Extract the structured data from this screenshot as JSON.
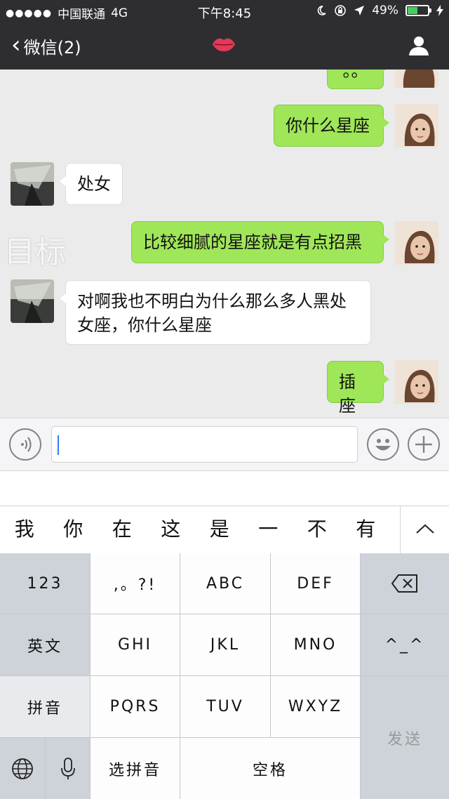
{
  "status_bar": {
    "carrier": "中国联通",
    "network": "4G",
    "time": "下午8:45",
    "battery": "49%",
    "battery_level": 0.49
  },
  "nav": {
    "back_label": "微信(2)",
    "title_icon": "lips-icon",
    "right_icon": "person-icon"
  },
  "messages": [
    {
      "side": "out",
      "text": "。。",
      "partial": true
    },
    {
      "side": "out",
      "text": "你什么星座"
    },
    {
      "side": "in",
      "text": "处女"
    },
    {
      "side": "out",
      "text": "比较细腻的星座就是有点招黑"
    },
    {
      "side": "in",
      "text": "对啊我也不明白为什么那么多人黑处女座，你什么星座"
    },
    {
      "side": "out",
      "text": "插座"
    }
  ],
  "watermark": "目标",
  "input": {
    "value": "",
    "voice_icon": "voice-icon",
    "emoji_icon": "emoji-icon",
    "plus_icon": "plus-icon"
  },
  "candidates": [
    "我",
    "你",
    "在",
    "这",
    "是",
    "一",
    "不",
    "有"
  ],
  "keyboard": {
    "num": "123",
    "punct": ",。?!",
    "abc": "ABC",
    "def": "DEF",
    "en": "英文",
    "ghi": "GHI",
    "jkl": "JKL",
    "mno": "MNO",
    "face": "^_^",
    "pinyin": "拼音",
    "pqrs": "PQRS",
    "tuv": "TUV",
    "wxyz": "WXYZ",
    "send": "发送",
    "select_pinyin": "选拼音",
    "space": "空格"
  },
  "colors": {
    "nav_bg": "#2e2e31",
    "chat_bg": "#ebebeb",
    "bubble_out": "#9fe658",
    "bubble_in": "#ffffff",
    "battery_fill": "#43d15b"
  }
}
